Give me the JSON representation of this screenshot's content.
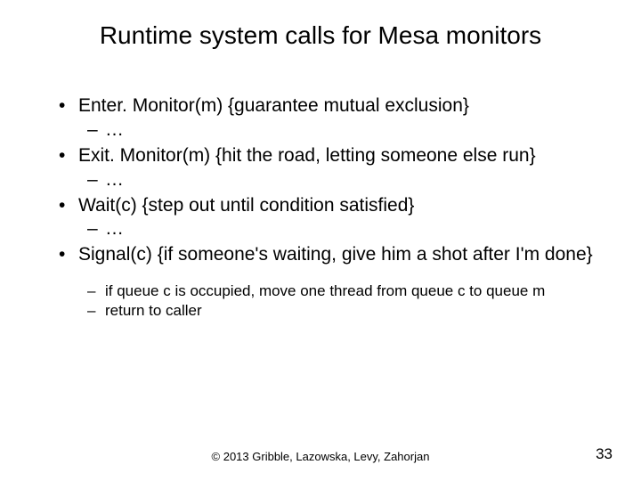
{
  "title": "Runtime system calls for Mesa monitors",
  "bullets": {
    "b1": "Enter. Monitor(m) {guarantee mutual exclusion}",
    "b1s1": "…",
    "b2": "Exit. Monitor(m) {hit the road, letting someone else run}",
    "b2s1": "…",
    "b3": "Wait(c) {step out until condition satisfied}",
    "b3s1": "…",
    "b4": "Signal(c) {if someone's waiting, give him a shot after I'm done}",
    "b4s1": "if queue c is occupied, move one thread from queue c to queue m",
    "b4s2": "return to caller"
  },
  "footer": {
    "copyright": "© 2013 Gribble, Lazowska, Levy, Zahorjan",
    "page": "33"
  }
}
